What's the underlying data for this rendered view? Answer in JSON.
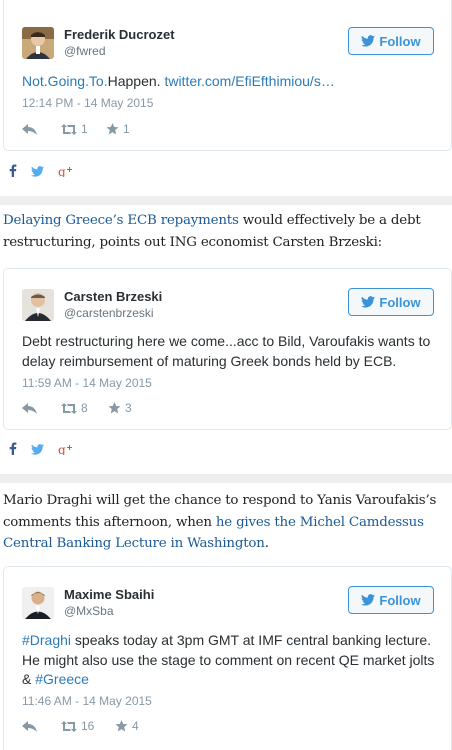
{
  "follow_label": "Follow",
  "colors": {
    "link": "#2b7bb9",
    "follow_border": "#3b94d9",
    "meta_gray": "#8899a6",
    "facebook": "#3b5998",
    "twitter": "#55acee",
    "google_plus": "#dd4b39"
  },
  "tweets": [
    {
      "author": "Frederik Ducrozet",
      "handle": "@fwred",
      "text_link1": "Not.Going.To.",
      "text_plain": "Happen. ",
      "text_link2": "twitter.com/EfiEfthimiou/s…",
      "time": "12:14 PM - 14 May 2015",
      "retweets": "1",
      "favorites": "1"
    },
    {
      "author": "Carsten Brzeski",
      "handle": "@carstenbrzeski",
      "text": "Debt restructuring here we come...acc to Bild, Varoufakis wants to delay reimbursement of maturing Greek bonds held by ECB.",
      "time": "11:59 AM - 14 May 2015",
      "retweets": "8",
      "favorites": "3"
    },
    {
      "author": "Maxime Sbaihi",
      "handle": "@MxSba",
      "text_hashtag1": "#Draghi",
      "text_middle": " speaks today at 3pm GMT at IMF central banking lecture. He might also use the stage to comment on recent QE market jolts & ",
      "text_hashtag2": "#Greece",
      "time": "11:46 AM - 14 May 2015",
      "retweets": "16",
      "favorites": "4"
    }
  ],
  "paragraphs": [
    {
      "link": "Delaying Greece’s ECB repayments",
      "rest": " would effectively be a debt restructuring, points out ING economist Carsten Brzeski:"
    },
    {
      "before": "Mario Draghi will get the chance to respond to Yanis Varoufakis’s comments this afternoon, when ",
      "link": "he gives the Michel Camdessus Central Banking Lecture in Washington",
      "after": "."
    }
  ]
}
